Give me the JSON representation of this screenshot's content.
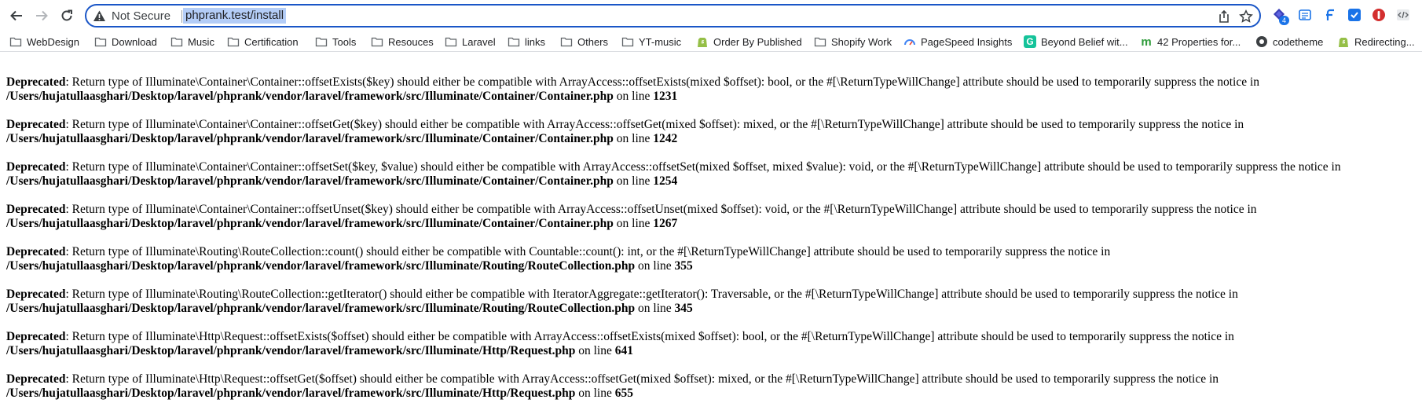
{
  "browser": {
    "omnibox": {
      "security_label": "Not Secure",
      "url": "phprank.test/install"
    },
    "extensions": [
      {
        "icon": "diamond-extension-icon",
        "badge": "4"
      },
      {
        "icon": "reader-extension-icon"
      },
      {
        "icon": "f-extension-icon"
      },
      {
        "icon": "shield-extension-icon"
      },
      {
        "icon": "stop-extension-icon"
      },
      {
        "icon": "code-extension-icon"
      }
    ]
  },
  "bookmarks": [
    {
      "label": "WebDesign",
      "icon": "folder-icon"
    },
    {
      "label": "Download",
      "icon": "folder-icon"
    },
    {
      "label": "Music",
      "icon": "folder-icon"
    },
    {
      "label": "Certification",
      "icon": "folder-icon"
    },
    {
      "label": "Tools",
      "icon": "folder-icon"
    },
    {
      "label": "Resouces",
      "icon": "folder-icon"
    },
    {
      "label": "Laravel",
      "icon": "folder-icon"
    },
    {
      "label": "links",
      "icon": "folder-icon"
    },
    {
      "label": "Others",
      "icon": "folder-icon"
    },
    {
      "label": "YT-music",
      "icon": "folder-icon"
    },
    {
      "label": "Order By Published",
      "icon": "shopify-icon"
    },
    {
      "label": "Shopify Work",
      "icon": "folder-icon"
    },
    {
      "label": "PageSpeed Insights",
      "icon": "pagespeed-icon"
    },
    {
      "label": "Beyond Belief wit...",
      "icon": "g-icon"
    },
    {
      "label": "42 Properties for...",
      "icon": "m-icon"
    },
    {
      "label": "codetheme",
      "icon": "codetheme-icon"
    },
    {
      "label": "Redirecting...",
      "icon": "shopify-icon"
    }
  ],
  "notices": [
    {
      "label": "Deprecated",
      "message": ": Return type of Illuminate\\Container\\Container::offsetExists($key) should either be compatible with ArrayAccess::offsetExists(mixed $offset): bool, or the #[\\ReturnTypeWillChange] attribute should be used to temporarily suppress the notice in",
      "file": "/Users/hujatullaasghari/Desktop/laravel/phprank/vendor/laravel/framework/src/Illuminate/Container/Container.php",
      "on_line": " on line ",
      "line": "1231"
    },
    {
      "label": "Deprecated",
      "message": ": Return type of Illuminate\\Container\\Container::offsetGet($key) should either be compatible with ArrayAccess::offsetGet(mixed $offset): mixed, or the #[\\ReturnTypeWillChange] attribute should be used to temporarily suppress the notice in",
      "file": "/Users/hujatullaasghari/Desktop/laravel/phprank/vendor/laravel/framework/src/Illuminate/Container/Container.php",
      "on_line": " on line ",
      "line": "1242"
    },
    {
      "label": "Deprecated",
      "message": ": Return type of Illuminate\\Container\\Container::offsetSet($key, $value) should either be compatible with ArrayAccess::offsetSet(mixed $offset, mixed $value): void, or the #[\\ReturnTypeWillChange] attribute should be used to temporarily suppress the notice in",
      "file": "/Users/hujatullaasghari/Desktop/laravel/phprank/vendor/laravel/framework/src/Illuminate/Container/Container.php",
      "on_line": " on line ",
      "line": "1254"
    },
    {
      "label": "Deprecated",
      "message": ": Return type of Illuminate\\Container\\Container::offsetUnset($key) should either be compatible with ArrayAccess::offsetUnset(mixed $offset): void, or the #[\\ReturnTypeWillChange] attribute should be used to temporarily suppress the notice in",
      "file": "/Users/hujatullaasghari/Desktop/laravel/phprank/vendor/laravel/framework/src/Illuminate/Container/Container.php",
      "on_line": " on line ",
      "line": "1267"
    },
    {
      "label": "Deprecated",
      "message": ": Return type of Illuminate\\Routing\\RouteCollection::count() should either be compatible with Countable::count(): int, or the #[\\ReturnTypeWillChange] attribute should be used to temporarily suppress the notice in",
      "file": "/Users/hujatullaasghari/Desktop/laravel/phprank/vendor/laravel/framework/src/Illuminate/Routing/RouteCollection.php",
      "on_line": " on line ",
      "line": "355"
    },
    {
      "label": "Deprecated",
      "message": ": Return type of Illuminate\\Routing\\RouteCollection::getIterator() should either be compatible with IteratorAggregate::getIterator(): Traversable, or the #[\\ReturnTypeWillChange] attribute should be used to temporarily suppress the notice in",
      "file": "/Users/hujatullaasghari/Desktop/laravel/phprank/vendor/laravel/framework/src/Illuminate/Routing/RouteCollection.php",
      "on_line": " on line ",
      "line": "345"
    },
    {
      "label": "Deprecated",
      "message": ": Return type of Illuminate\\Http\\Request::offsetExists($offset) should either be compatible with ArrayAccess::offsetExists(mixed $offset): bool, or the #[\\ReturnTypeWillChange] attribute should be used to temporarily suppress the notice in",
      "file": "/Users/hujatullaasghari/Desktop/laravel/phprank/vendor/laravel/framework/src/Illuminate/Http/Request.php",
      "on_line": " on line ",
      "line": "641"
    },
    {
      "label": "Deprecated",
      "message": ": Return type of Illuminate\\Http\\Request::offsetGet($offset) should either be compatible with ArrayAccess::offsetGet(mixed $offset): mixed, or the #[\\ReturnTypeWillChange] attribute should be used to temporarily suppress the notice in",
      "file": "/Users/hujatullaasghari/Desktop/laravel/phprank/vendor/laravel/framework/src/Illuminate/Http/Request.php",
      "on_line": " on line ",
      "line": "655"
    }
  ]
}
